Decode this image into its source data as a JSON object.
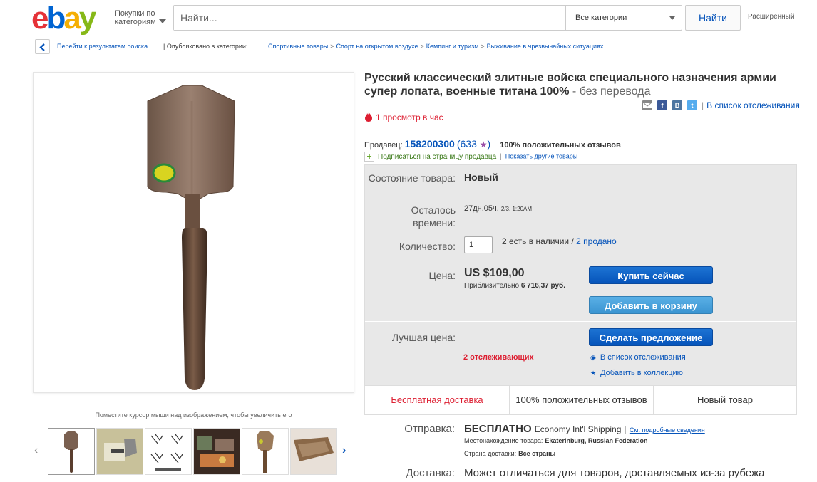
{
  "header": {
    "logo": {
      "e": "e",
      "b": "b",
      "a": "a",
      "y": "y"
    },
    "shop_by": "Покупки по категориям",
    "search_placeholder": "Найти...",
    "category": "Все категории",
    "search_button": "Найти",
    "advanced": "Расширенный"
  },
  "breadcrumb": {
    "back": "Перейти к результатам поиска",
    "published": "| Опубликовано в категории:",
    "items": [
      "Спортивные товары",
      "Спорт на открытом воздухе",
      "Кемпинг и туризм",
      "Выживание в чрезвычайных ситуациях"
    ],
    "separator": ">"
  },
  "image": {
    "hover_hint": "Поместите курсор мыши над изображением, чтобы увеличить его",
    "thumb_count": 6
  },
  "listing": {
    "title": "Русский классический элитные войска специального назначения армии супер лопата, военные титана 100%",
    "title_suffix": " - без перевода",
    "watch_list": "В список отслеживания",
    "views": "1 просмотр в час",
    "share_icons": [
      "mail-icon",
      "facebook-icon",
      "vk-icon",
      "twitter-icon"
    ]
  },
  "seller": {
    "label": "Продавец:",
    "name": "158200300",
    "score_open": "(633",
    "score_close": ")",
    "positive": "100% положительных отзывов",
    "subscribe": "Подписаться на страницу продавца",
    "sep": "|",
    "other": "Показать другие товары"
  },
  "panel": {
    "condition_label": "Состояние товара:",
    "condition": "Новый",
    "time_label": "Осталось времени:",
    "time_main": "27дн.05ч.",
    "time_small": "2/3, 1:20AM",
    "qty_label": "Количество:",
    "qty_value": "1",
    "available": "2 есть в наличии /",
    "sold": "2 продано",
    "price_label": "Цена:",
    "price": "US $109,00",
    "approx_label": "Приблизительно",
    "approx_value": "6 716,37 руб.",
    "buy_now": "Купить сейчас",
    "add_cart": "Добавить в корзину",
    "best_offer_label": "Лучшая цена:",
    "make_offer": "Сделать предложение",
    "watchers": "2 отслеживающих",
    "watch_list": "В список отслеживания",
    "add_collection": "Добавить в коллекцию",
    "badges": [
      "Бесплатная доставка",
      "100% положительных отзывов",
      "Новый товар"
    ]
  },
  "shipping": {
    "label": "Отправка:",
    "free": "БЕСПЛАТНО",
    "service": "Economy Int'l Shipping",
    "bar": "|",
    "details": "См. подробные сведения",
    "location_label": "Местонахождение товара:",
    "location": "Ekaterinburg, Russian Federation",
    "countries_label": "Страна доставки:",
    "countries": "Все страны",
    "delivery_label": "Доставка:",
    "delivery": "Может отличаться для товаров, доставляемых из-за рубежа"
  },
  "colors": {
    "link": "#0654ba",
    "red": "#dd1e31",
    "buy_button": "#0654ba",
    "cart_button": "#3a94d1"
  }
}
